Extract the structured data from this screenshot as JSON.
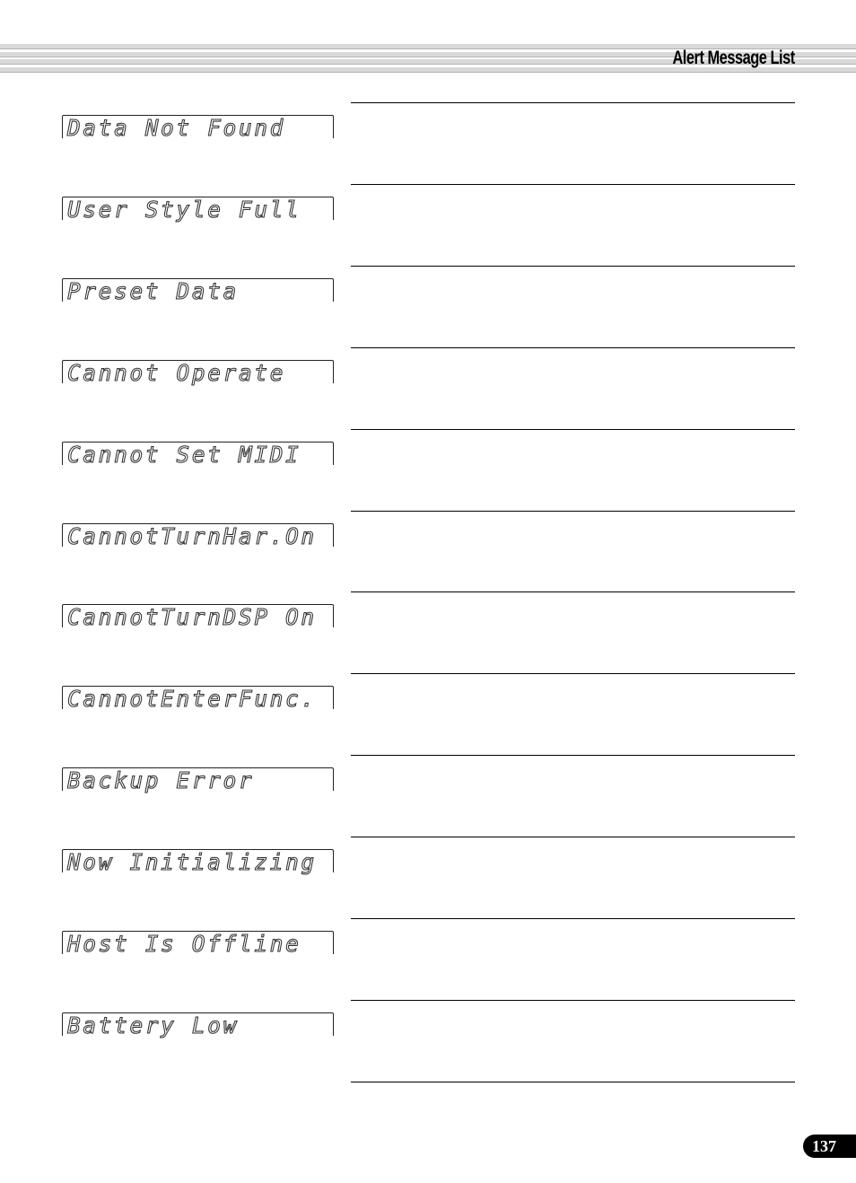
{
  "header": {
    "title": "Alert Message List"
  },
  "messages": [
    {
      "lcd_text": "Data Not Found"
    },
    {
      "lcd_text": "User Style Full"
    },
    {
      "lcd_text": "Preset Data"
    },
    {
      "lcd_text": "Cannot Operate"
    },
    {
      "lcd_text": "Cannot Set MIDI"
    },
    {
      "lcd_text": "CannotTurnHar.On"
    },
    {
      "lcd_text": "CannotTurnDSP On"
    },
    {
      "lcd_text": "CannotEnterFunc."
    },
    {
      "lcd_text": "Backup Error"
    },
    {
      "lcd_text": "Now Initializing"
    },
    {
      "lcd_text": "Host Is Offline"
    },
    {
      "lcd_text": "Battery Low"
    }
  ],
  "footer": {
    "page_number": "137"
  }
}
